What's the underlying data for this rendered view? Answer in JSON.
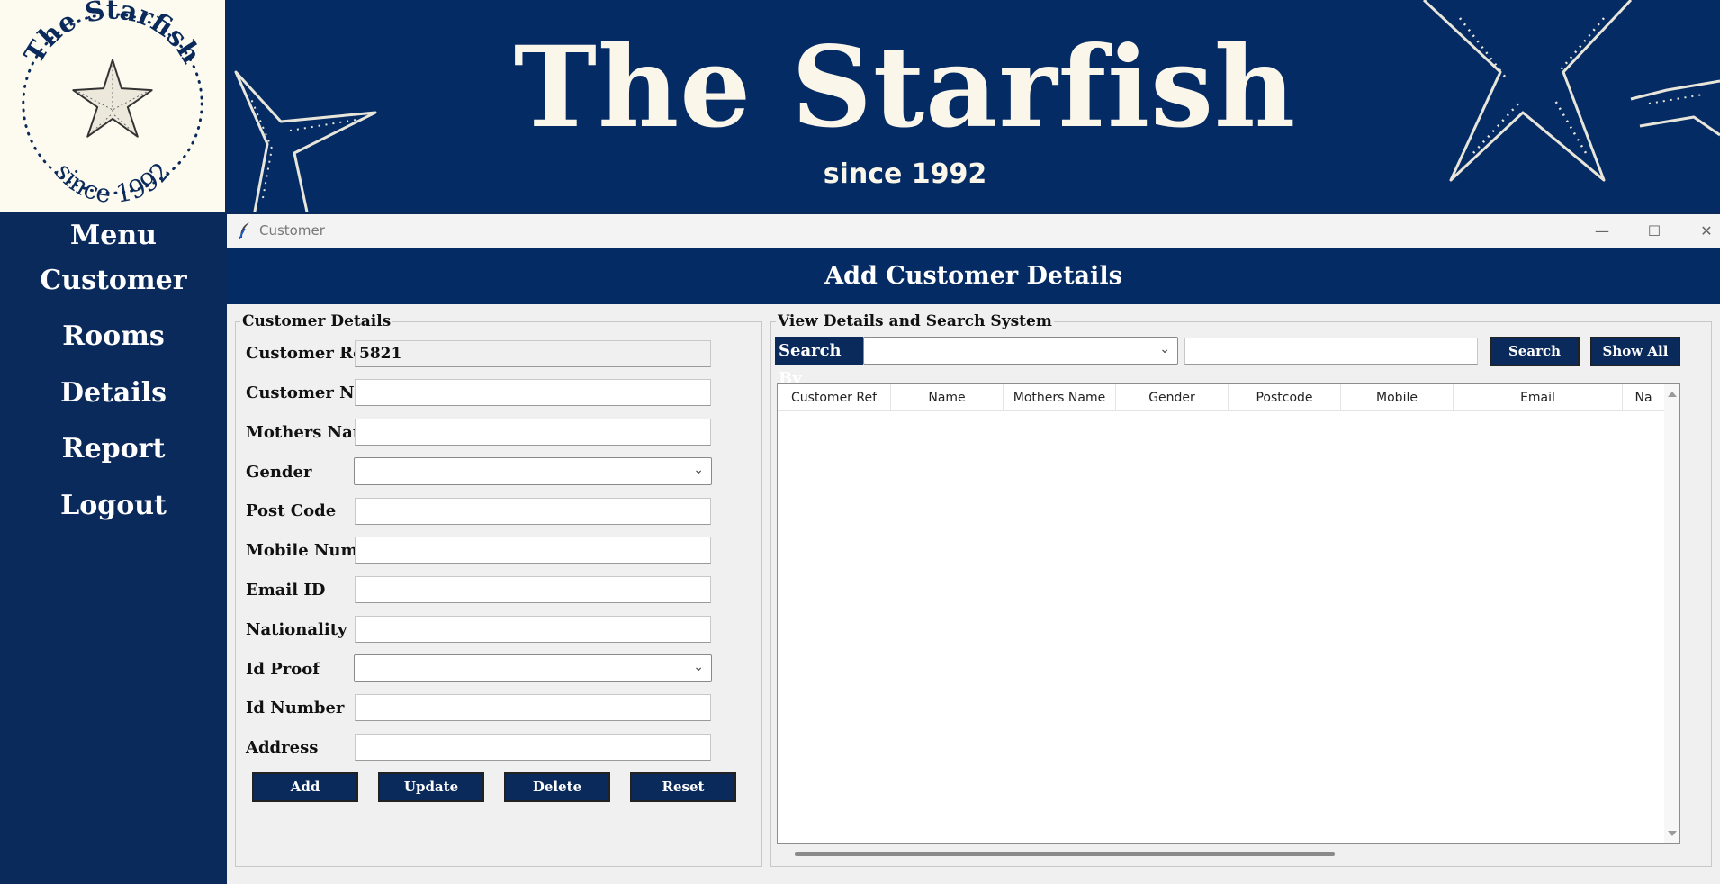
{
  "logo": {
    "text_top": "The Starfish",
    "text_bottom": "since 1992"
  },
  "banner": {
    "title": "The Starfish",
    "subtitle": "since 1992"
  },
  "sidebar": {
    "heading": "Menu",
    "items": [
      {
        "label": "Customer"
      },
      {
        "label": "Rooms"
      },
      {
        "label": "Details"
      },
      {
        "label": "Report"
      },
      {
        "label": "Logout"
      }
    ]
  },
  "window": {
    "title": "Customer",
    "minimize": "—",
    "maximize": "☐",
    "close": "✕",
    "header": "Add Customer Details"
  },
  "customer_details": {
    "legend": "Customer Details",
    "fields": {
      "customer_ref": {
        "label": "Customer Ref",
        "value": "5821"
      },
      "customer_name": {
        "label": "Customer Name",
        "value": ""
      },
      "mothers_name": {
        "label": "Mothers Name",
        "value": ""
      },
      "gender": {
        "label": "Gender",
        "value": ""
      },
      "post_code": {
        "label": "Post Code",
        "value": ""
      },
      "mobile_number": {
        "label": "Mobile Number",
        "value": ""
      },
      "email_id": {
        "label": "Email ID",
        "value": ""
      },
      "nationality": {
        "label": "Nationality",
        "value": ""
      },
      "id_proof": {
        "label": "Id Proof",
        "value": ""
      },
      "id_number": {
        "label": "Id Number",
        "value": ""
      },
      "address": {
        "label": "Address",
        "value": ""
      }
    },
    "buttons": {
      "add": "Add",
      "update": "Update",
      "delete": "Delete",
      "reset": "Reset"
    }
  },
  "search_system": {
    "legend": "View Details and Search System",
    "search_by_label": "Search By",
    "search_by_value": "",
    "search_text": "",
    "search_button": "Search",
    "show_all_button": "Show All",
    "columns": [
      "Customer Ref",
      "Name",
      "Mothers Name",
      "Gender",
      "Postcode",
      "Mobile",
      "Email",
      "Na"
    ]
  },
  "colors": {
    "navy": "#042b63",
    "sidebar": "#0b2a5c",
    "cream": "#fdfbf0"
  },
  "icons": {
    "window_icon": "feather-icon",
    "dropdown": "chevron-down-icon",
    "scroll_up": "triangle-up-icon",
    "scroll_down": "triangle-down-icon"
  }
}
